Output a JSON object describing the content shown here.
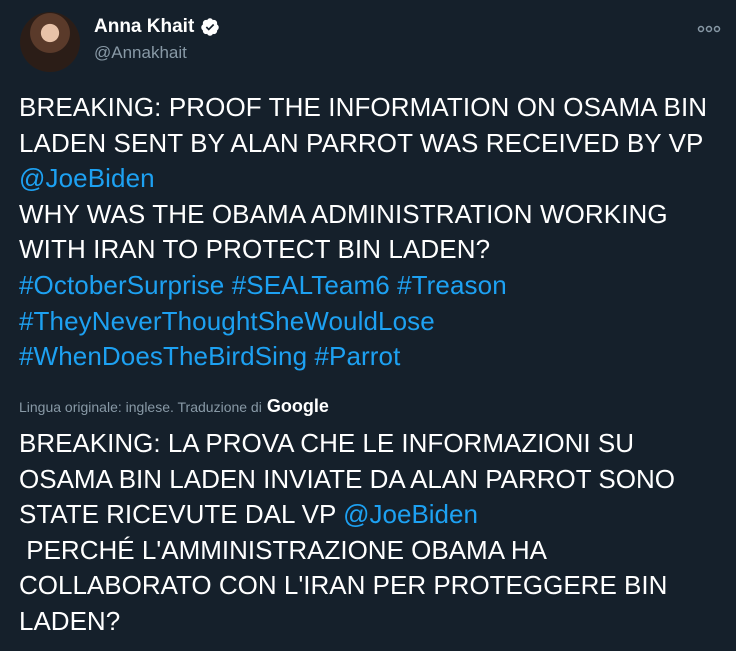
{
  "author": {
    "name": "Anna Khait",
    "handle": "@Annakhait"
  },
  "tweet": {
    "line1": "BREAKING: PROOF THE INFORMATION ON OSAMA BIN LADEN SENT BY ALAN PARROT WAS RECEIVED BY VP ",
    "mention1": "@JoeBiden",
    "line2": "WHY WAS THE OBAMA ADMINISTRATION WORKING WITH IRAN TO PROTECT BIN LADEN?",
    "hashtags": [
      "#OctoberSurprise",
      "#SEALTeam6",
      "#Treason",
      "#TheyNeverThoughtSheWouldLose",
      "#WhenDoesTheBirdSing",
      "#Parrot"
    ]
  },
  "translation": {
    "note": "Lingua originale: inglese. Traduzione di",
    "provider": "Google",
    "line1": "BREAKING: LA PROVA CHE LE INFORMAZIONI SU OSAMA BIN LADEN INVIATE DA ALAN PARROT SONO STATE RICEVUTE DAL VP ",
    "mention": "@JoeBiden",
    "line2": " PERCHÉ L'AMMINISTRAZIONE OBAMA HA COLLABORATO CON L'IRAN PER PROTEGGERE BIN LADEN?"
  },
  "colors": {
    "background": "#15202b",
    "link": "#1da1f2",
    "secondary_text": "#8899a6"
  },
  "icons": {
    "verified": "verified-badge-icon",
    "more": "more-options-icon"
  }
}
